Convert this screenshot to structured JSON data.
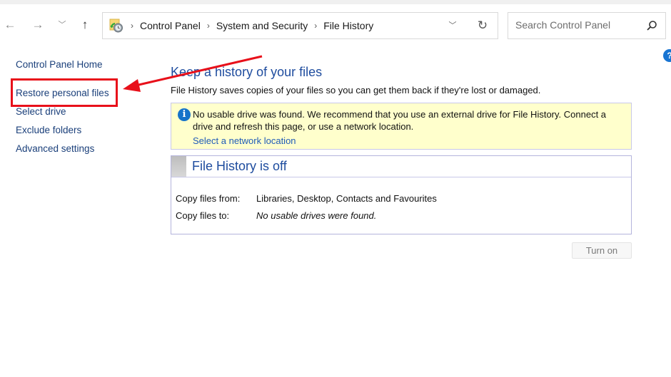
{
  "navigation": {
    "back_icon": "arrow-left",
    "forward_icon": "arrow-right",
    "recent_icon": "chevron-down",
    "up_icon": "arrow-up"
  },
  "address_bar": {
    "icon": "file-history-icon",
    "breadcrumbs": [
      "Control Panel",
      "System and Security",
      "File History"
    ],
    "separator": "›",
    "dropdown_icon": "chevron-down",
    "refresh_icon": "refresh"
  },
  "search": {
    "placeholder": "Search Control Panel",
    "icon": "magnifier"
  },
  "help": {
    "icon": "help",
    "label": "?"
  },
  "sidebar": {
    "items": [
      {
        "label": "Control Panel Home"
      },
      {
        "label": "Restore personal files",
        "highlighted": true
      },
      {
        "label": "Select drive"
      },
      {
        "label": "Exclude folders"
      },
      {
        "label": "Advanced settings"
      }
    ]
  },
  "annotation": {
    "highlight_color": "#e8101a",
    "arrow_color": "#e8101a"
  },
  "main": {
    "title": "Keep a history of your files",
    "description": "File History saves copies of your files so you can get them back if they're lost or damaged.",
    "info_bar": {
      "icon": "info",
      "icon_glyph": "i",
      "message": "No usable drive was found. We recommend that you use an external drive for File History. Connect a drive and refresh this page, or use a network location.",
      "link": "Select a network location"
    },
    "status_panel": {
      "title": "File History is off",
      "rows": [
        {
          "label": "Copy files from:",
          "value": "Libraries, Desktop, Contacts and Favourites",
          "italic": false
        },
        {
          "label": "Copy files to:",
          "value": "No usable drives were found.",
          "italic": true
        }
      ]
    },
    "turn_on_button": {
      "label": "Turn on",
      "enabled": false
    }
  },
  "colors": {
    "title_blue": "#1e4c9e",
    "link_blue": "#1f5bb8",
    "info_background": "#ffffcc",
    "panel_border": "#b4b4dc"
  }
}
